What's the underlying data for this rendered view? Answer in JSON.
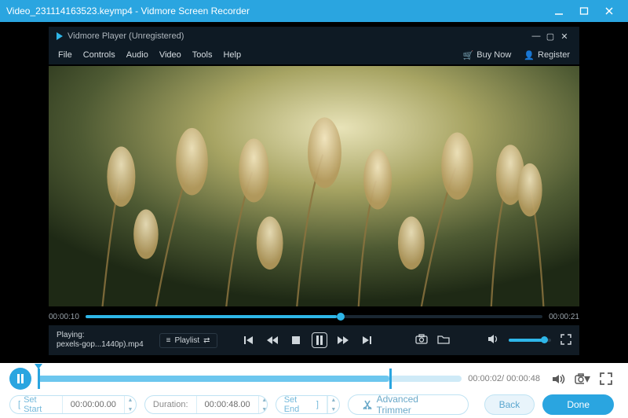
{
  "window": {
    "title": "Video_231114163523.keymp4  -  Vidmore Screen Recorder"
  },
  "player": {
    "brand": "Vidmore Player (Unregistered)",
    "menu": {
      "file": "File",
      "controls": "Controls",
      "audio": "Audio",
      "video": "Video",
      "tools": "Tools",
      "help": "Help"
    },
    "buy_now": "Buy Now",
    "register": "Register",
    "time_current": "00:00:10",
    "time_total": "00:00:21",
    "now_playing_label": "Playing:",
    "now_playing_file": "pexels-gop...1440p).mp4",
    "playlist_label": "Playlist"
  },
  "editor": {
    "current_time": "00:00:02",
    "total_time": "00:00:48",
    "set_start_label": "Set Start",
    "start_value": "00:00:00.00",
    "duration_label": "Duration:",
    "duration_value": "00:00:48.00",
    "set_end_label": "Set End",
    "advanced_trimmer": "Advanced Trimmer",
    "back": "Back",
    "done": "Done"
  }
}
